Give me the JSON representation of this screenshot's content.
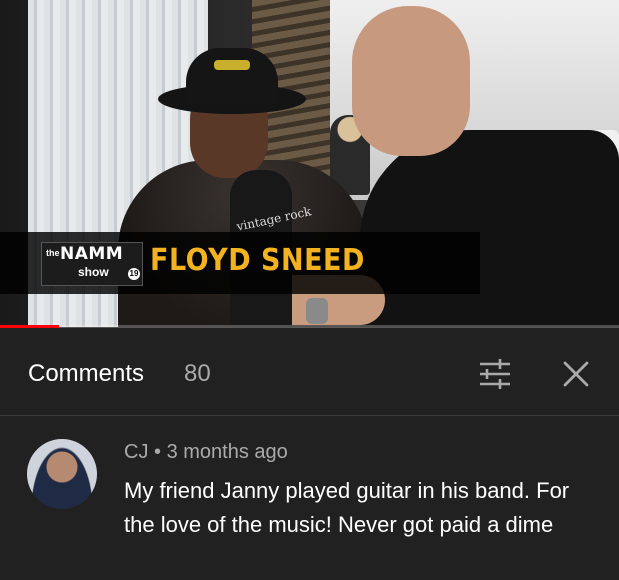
{
  "video": {
    "overlay": {
      "logo": {
        "prefix": "the",
        "word": "NAMM",
        "sub": "show",
        "year": "19"
      },
      "guest_name": "FLOYD SNEED",
      "mic_text": "vintage rock"
    },
    "progress_fraction": 0.095,
    "progress_color": "#ff0000",
    "name_color": "#f3b321"
  },
  "comments_panel": {
    "title": "Comments",
    "count": "80",
    "sort_icon": "sort-sliders-icon",
    "close_icon": "close-icon"
  },
  "comments": [
    {
      "author": "CJ",
      "separator": "•",
      "age": "3 months ago",
      "text": "My friend Janny played guitar in his band. For the love of the music! Never got paid a dime"
    }
  ]
}
